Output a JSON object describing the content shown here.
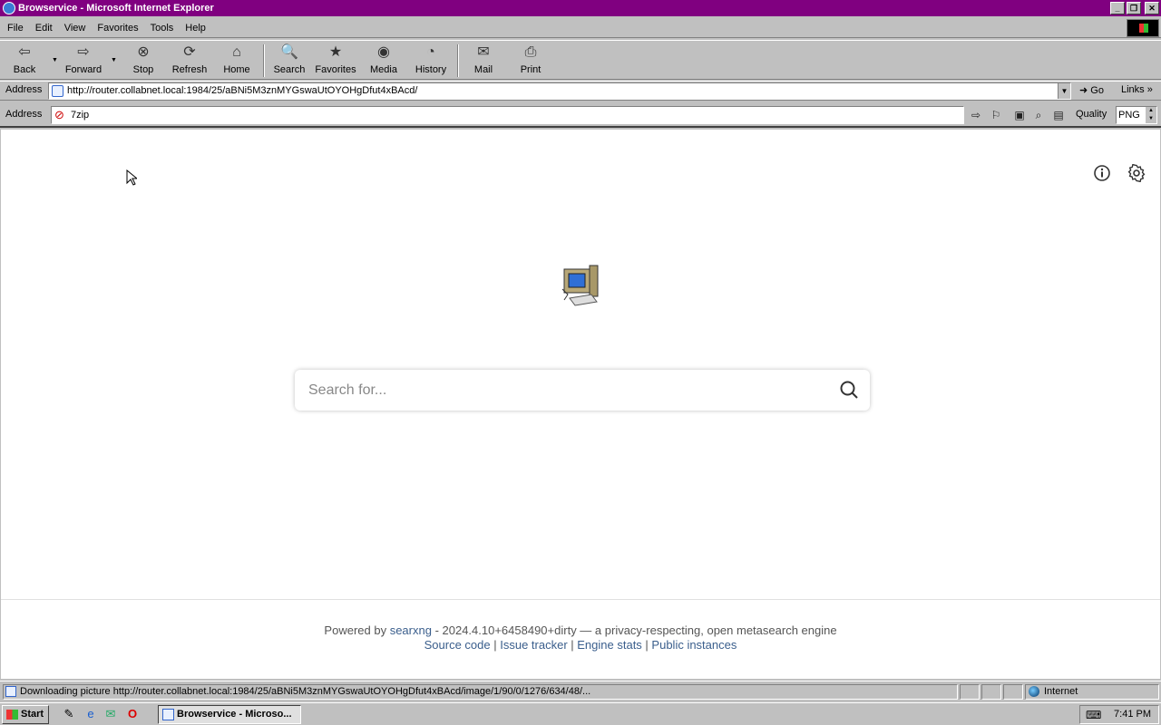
{
  "window": {
    "title": "Browservice - Microsoft Internet Explorer"
  },
  "menu": [
    "File",
    "Edit",
    "View",
    "Favorites",
    "Tools",
    "Help"
  ],
  "toolbar": {
    "back": "Back",
    "forward": "Forward",
    "stop": "Stop",
    "refresh": "Refresh",
    "home": "Home",
    "search": "Search",
    "favorites": "Favorites",
    "media": "Media",
    "history": "History",
    "mail": "Mail",
    "print": "Print"
  },
  "address": {
    "label": "Address",
    "url": "http://router.collabnet.local:1984/25/aBNi5M3znMYGswaUtOYOHgDfut4xBAcd/",
    "go": "Go",
    "links": "Links"
  },
  "address2": {
    "label": "Address",
    "value": "7zip",
    "quality_label": "Quality",
    "quality_value": "PNG"
  },
  "page": {
    "search_placeholder": "Search for...",
    "footer": {
      "powered_by": "Powered by",
      "searxng": "searxng",
      "version": " - 2024.4.10+6458490+dirty — a privacy-respecting, open metasearch engine",
      "source_code": "Source code",
      "issue_tracker": "Issue tracker",
      "engine_stats": "Engine stats",
      "public_instances": "Public instances",
      "sep": " | "
    }
  },
  "status": {
    "text": "Downloading picture http://router.collabnet.local:1984/25/aBNi5M3znMYGswaUtOYOHgDfut4xBAcd/image/1/90/0/1276/634/48/...",
    "zone": "Internet"
  },
  "taskbar": {
    "start": "Start",
    "task": "Browservice - Microso...",
    "clock": "7:41 PM"
  }
}
